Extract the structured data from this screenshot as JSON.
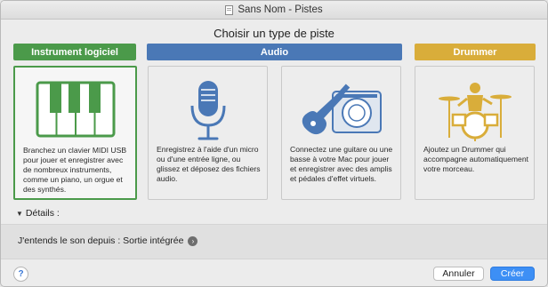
{
  "window": {
    "title": "Sans Nom - Pistes"
  },
  "heading": "Choisir un type de piste",
  "colors": {
    "instrument": "#4b9a4a",
    "audio": "#4a78b6",
    "drummer": "#d9ad3a",
    "create_button": "#3d8ff5"
  },
  "categories": {
    "instrument": "Instrument logiciel",
    "audio": "Audio",
    "drummer": "Drummer"
  },
  "cards": {
    "instrument": {
      "icon": "piano-keys-icon",
      "text": "Branchez un clavier MIDI USB pour jouer et enregistrer avec de nombreux instruments, comme un piano, un orgue et des synthés.",
      "selected": true
    },
    "microphone": {
      "icon": "microphone-icon",
      "text": "Enregistrez à l'aide d'un micro ou d'une entrée ligne, ou glissez et déposez des fichiers audio."
    },
    "guitar": {
      "icon": "guitar-amp-icon",
      "text": "Connectez une guitare ou une basse à votre Mac pour jouer et enregistrer avec des amplis et pédales d'effet virtuels."
    },
    "drummer": {
      "icon": "drummer-kit-icon",
      "text": "Ajoutez un Drummer qui accompagne automatiquement votre morceau."
    }
  },
  "details": {
    "label": "Détails :"
  },
  "sound": {
    "label": "J'entends le son depuis : Sortie intégrée"
  },
  "buttons": {
    "help": "?",
    "cancel": "Annuler",
    "create": "Créer"
  }
}
